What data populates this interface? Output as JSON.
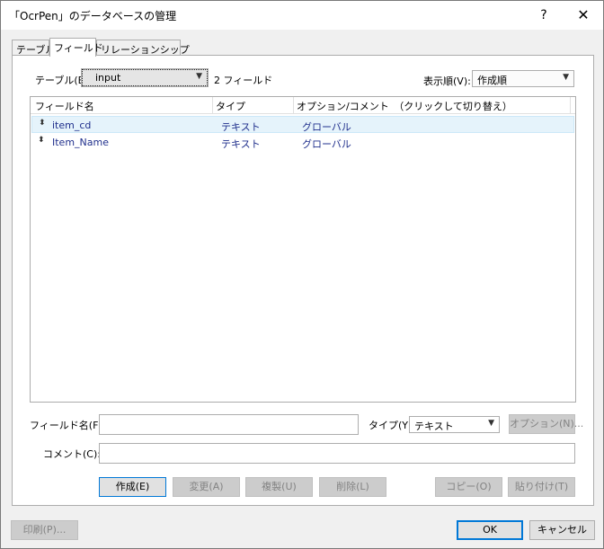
{
  "window": {
    "title": "「OcrPen」のデータベースの管理",
    "help_label": "?",
    "close_label": "✕"
  },
  "tabs": [
    {
      "label": "テーブル",
      "active": false
    },
    {
      "label": "フィールド",
      "active": true
    },
    {
      "label": "リレーションシップ",
      "active": false
    }
  ],
  "table_selector": {
    "label": "テーブル(B):",
    "value": "input",
    "field_count": "2 フィールド"
  },
  "sort": {
    "label": "表示順(V):",
    "value": "作成順"
  },
  "field_list": {
    "columns": [
      "フィールド名",
      "タイプ",
      "オプション/コメント　（クリックして切り替え）"
    ],
    "rows": [
      {
        "name": "item_cd",
        "type": "テキスト",
        "options": "グローバル"
      },
      {
        "name": "Item_Name",
        "type": "テキスト",
        "options": "グローバル"
      }
    ]
  },
  "form": {
    "field_name_label": "フィールド名(F):",
    "field_name_value": "",
    "type_label": "タイプ(Y):",
    "type_value": "テキスト",
    "options_button": "オプション(N)...",
    "comment_label": "コメント(C):",
    "comment_value": ""
  },
  "actions": {
    "create": "作成(E)",
    "change": "変更(A)",
    "duplicate": "複製(U)",
    "delete": "削除(L)",
    "copy": "コピー(O)",
    "paste": "貼り付け(T)"
  },
  "footer": {
    "print": "印刷(P)...",
    "ok": "OK",
    "cancel": "キャンセル"
  }
}
